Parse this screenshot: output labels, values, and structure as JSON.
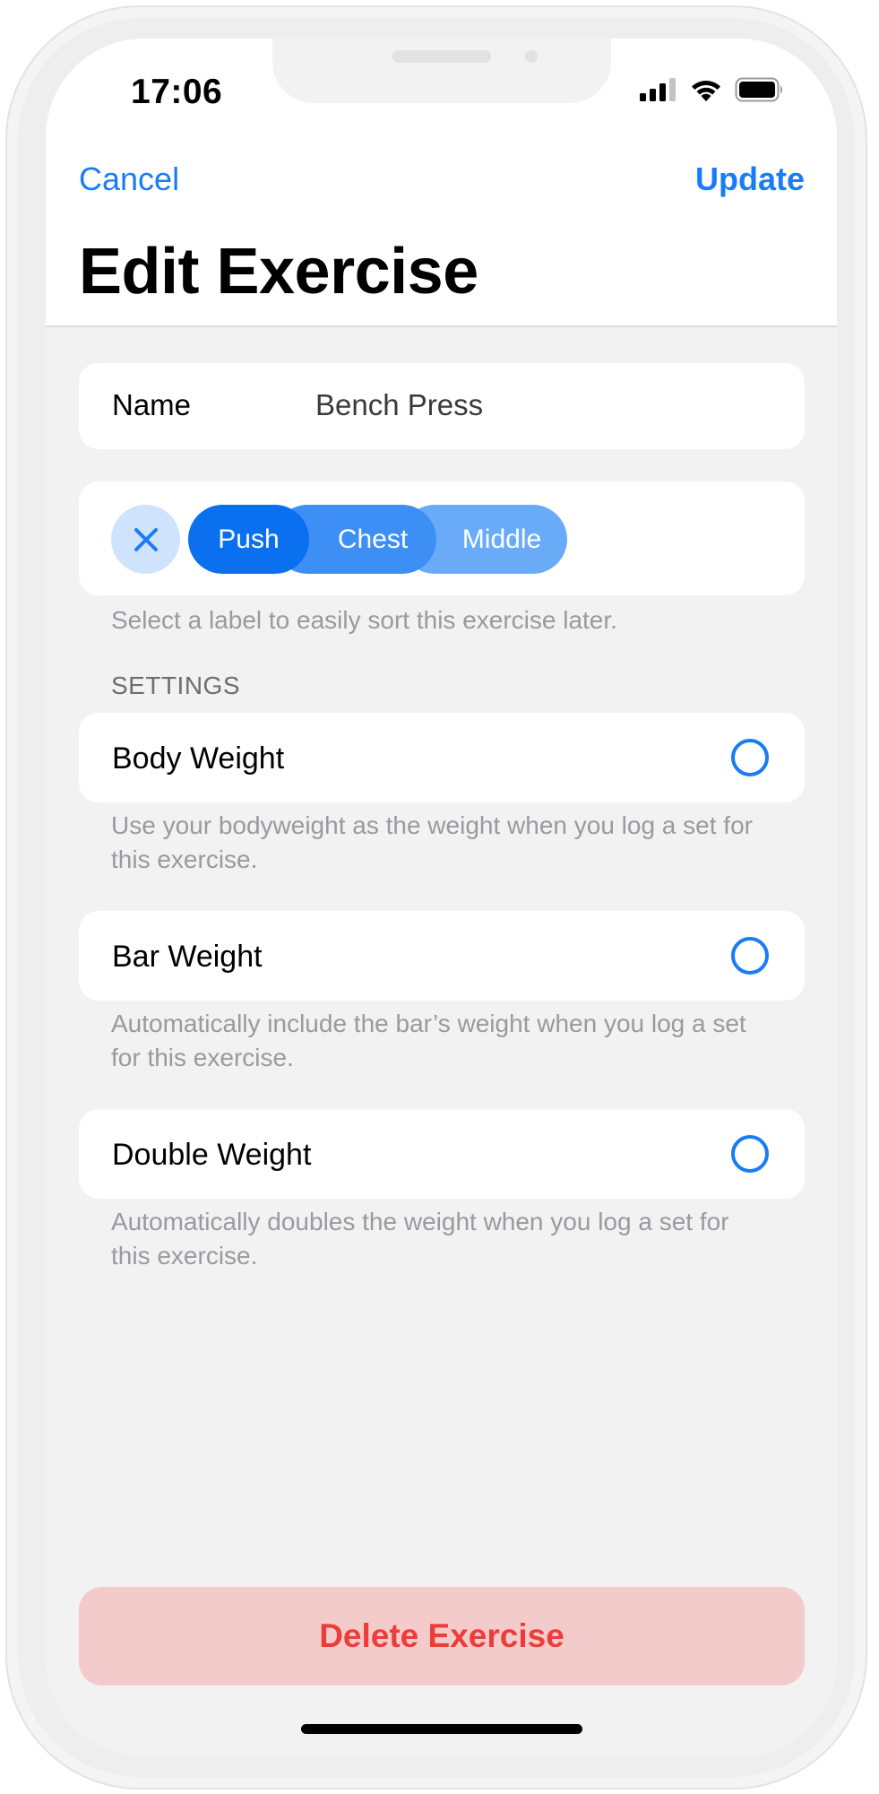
{
  "status_bar": {
    "time": "17:06",
    "icons": [
      "signal-icon",
      "wifi-icon",
      "battery-icon"
    ]
  },
  "nav": {
    "cancel_label": "Cancel",
    "update_label": "Update",
    "title": "Edit Exercise"
  },
  "name_field": {
    "label": "Name",
    "value": "Bench Press"
  },
  "labels": {
    "clear_icon": "close-icon",
    "tags": [
      "Push",
      "Chest",
      "Middle"
    ],
    "helper": "Select a label to easily sort this exercise later."
  },
  "settings": {
    "header": "SETTINGS",
    "items": [
      {
        "label": "Body Weight",
        "helper": "Use your bodyweight as the weight when you log a set for this exercise.",
        "checked": false
      },
      {
        "label": "Bar Weight",
        "helper": "Automatically include the bar’s weight when you log a set for this exercise.",
        "checked": false
      },
      {
        "label": "Double Weight",
        "helper": "Automatically doubles the weight when you log a set for this exercise.",
        "checked": false
      }
    ]
  },
  "delete_label": "Delete Exercise",
  "colors": {
    "accent": "#1a7cf5",
    "destructive": "#eb3d3a",
    "destructive_bg": "#f4cbcb"
  }
}
